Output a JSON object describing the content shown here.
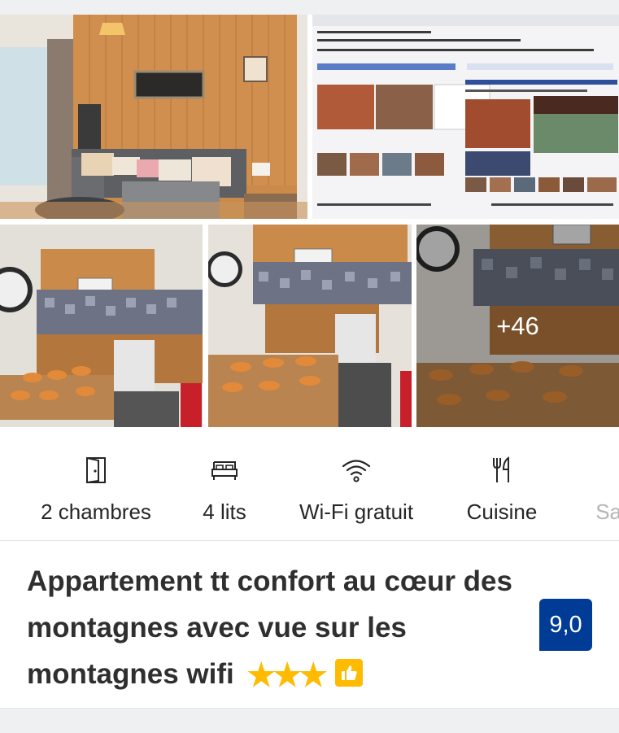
{
  "gallery": {
    "more_count": "+46"
  },
  "amenities": [
    {
      "label": "2 chambres",
      "icon": "door-icon"
    },
    {
      "label": "4 lits",
      "icon": "bed-icon"
    },
    {
      "label": "Wi-Fi gratuit",
      "icon": "wifi-icon"
    },
    {
      "label": "Cuisine",
      "icon": "utensils-icon"
    },
    {
      "label": "Sal",
      "icon": "none"
    }
  ],
  "property": {
    "title": "Appartement tt confort au cœur des montagnes avec vue sur les montagnes wifi",
    "stars": 3,
    "score": "9,0"
  },
  "colors": {
    "accent": "#003b95",
    "star": "#febb02"
  }
}
